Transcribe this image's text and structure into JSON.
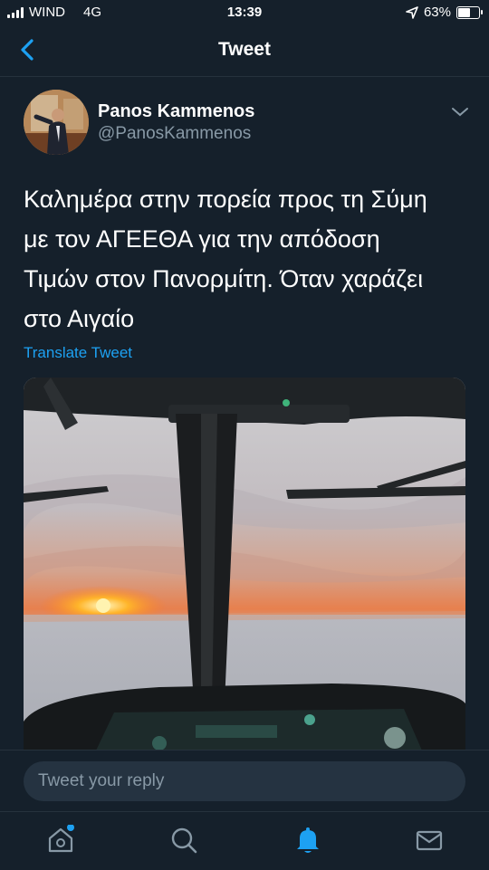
{
  "status_bar": {
    "carrier": "WIND",
    "network": "4G",
    "time": "13:39",
    "battery_percent": "63%",
    "battery_level": 0.63
  },
  "nav": {
    "title": "Tweet"
  },
  "author": {
    "name": "Panos Kammenos",
    "handle": "@PanosKammenos"
  },
  "tweet": {
    "lines": [
      "Καλημέρα στην πορεία προς τη Σύμη",
      "με τον ΑΓΕΕΘΑ για την απόδοση",
      "Τιμών στον Πανορμίτη. Όταν χαράζει",
      "στο Αιγαίο"
    ],
    "translate_label": "Translate Tweet"
  },
  "reply": {
    "placeholder": "Tweet your reply"
  },
  "tabs": [
    {
      "icon": "home-icon",
      "notification_dot": true
    },
    {
      "icon": "search-icon"
    },
    {
      "icon": "bell-icon",
      "active": true
    },
    {
      "icon": "mail-icon"
    }
  ],
  "colors": {
    "background": "#15202b",
    "accent": "#1da1f2",
    "secondary_text": "#8899a6"
  }
}
